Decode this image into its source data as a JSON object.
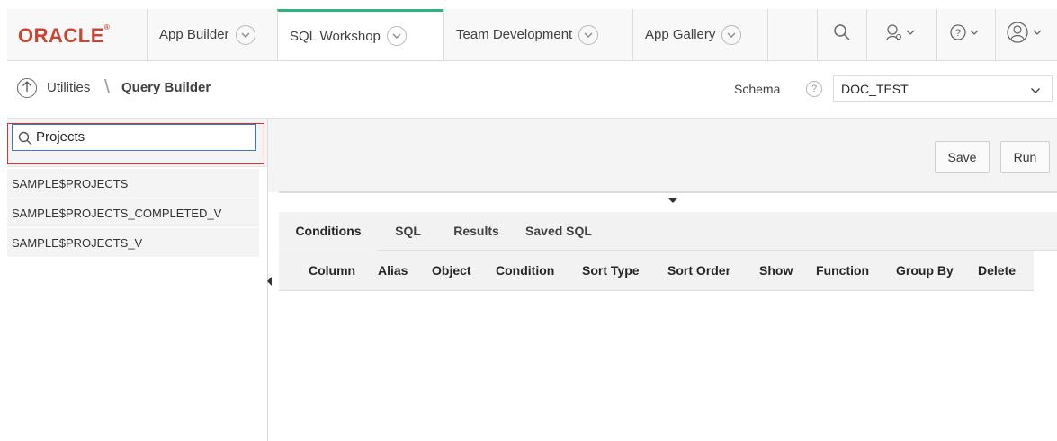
{
  "brand": {
    "logo": "ORACLE"
  },
  "nav": {
    "tabs": [
      {
        "label": "App Builder"
      },
      {
        "label": "SQL Workshop"
      },
      {
        "label": "Team Development"
      },
      {
        "label": "App Gallery"
      }
    ],
    "icons": [
      "search-icon",
      "admin-user-icon",
      "help-icon",
      "user-avatar-icon"
    ]
  },
  "breadcrumb": {
    "parent": "Utilities",
    "separator": "\\",
    "current": "Query Builder"
  },
  "schema": {
    "label": "Schema",
    "help": "?",
    "value": "DOC_TEST"
  },
  "search": {
    "value": "Projects",
    "placeholder": ""
  },
  "objects": [
    "SAMPLE$PROJECTS",
    "SAMPLE$PROJECTS_COMPLETED_V",
    "SAMPLE$PROJECTS_V"
  ],
  "toolbar": {
    "save": "Save",
    "run": "Run"
  },
  "query_tabs": [
    "Conditions",
    "SQL",
    "Results",
    "Saved SQL"
  ],
  "columns": [
    "Column",
    "Alias",
    "Object",
    "Condition",
    "Sort Type",
    "Sort Order",
    "Show",
    "Function",
    "Group By",
    "Delete"
  ],
  "colors": {
    "brand_red": "#c74634",
    "active_tab_accent": "#2db67c",
    "search_focus": "#3a77c4",
    "highlight": "#e03030"
  }
}
